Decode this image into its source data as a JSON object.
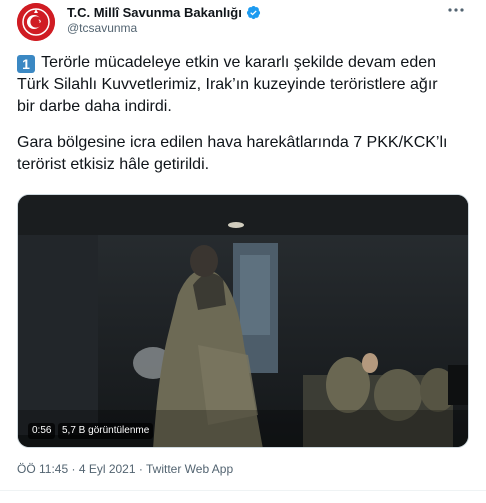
{
  "account": {
    "name": "T.C. Millî Savunma Bakanlığı",
    "handle": "@tcsavunma",
    "avatar_icon": "turkish-flag-emblem-icon",
    "verified_icon": "verified-badge-icon",
    "verified_color": "#1d9bf0"
  },
  "tweet": {
    "keycap": "1",
    "paragraph1": " Terörle mücadeleye etkin ve kararlı şekilde devam eden Türk Silahlı Kuvvetlerimiz, Irak’ın kuzeyinde teröristlere ağır bir darbe daha indirdi.",
    "paragraph2": "Gara bölgesine icra edilen hava harekâtlarında 7 PKK/KCK’lı terörist etkisiz hâle getirildi."
  },
  "video": {
    "duration": "0:56",
    "views": "5,7 B görüntülenme"
  },
  "meta": {
    "time": "ÖÖ 11:45",
    "sep1": " · ",
    "date": "4 Eyl 2021",
    "sep2": " · ",
    "source": "Twitter Web App"
  },
  "colors": {
    "text": "#0f1419",
    "muted": "#536471",
    "brand_red": "#d01c23"
  }
}
